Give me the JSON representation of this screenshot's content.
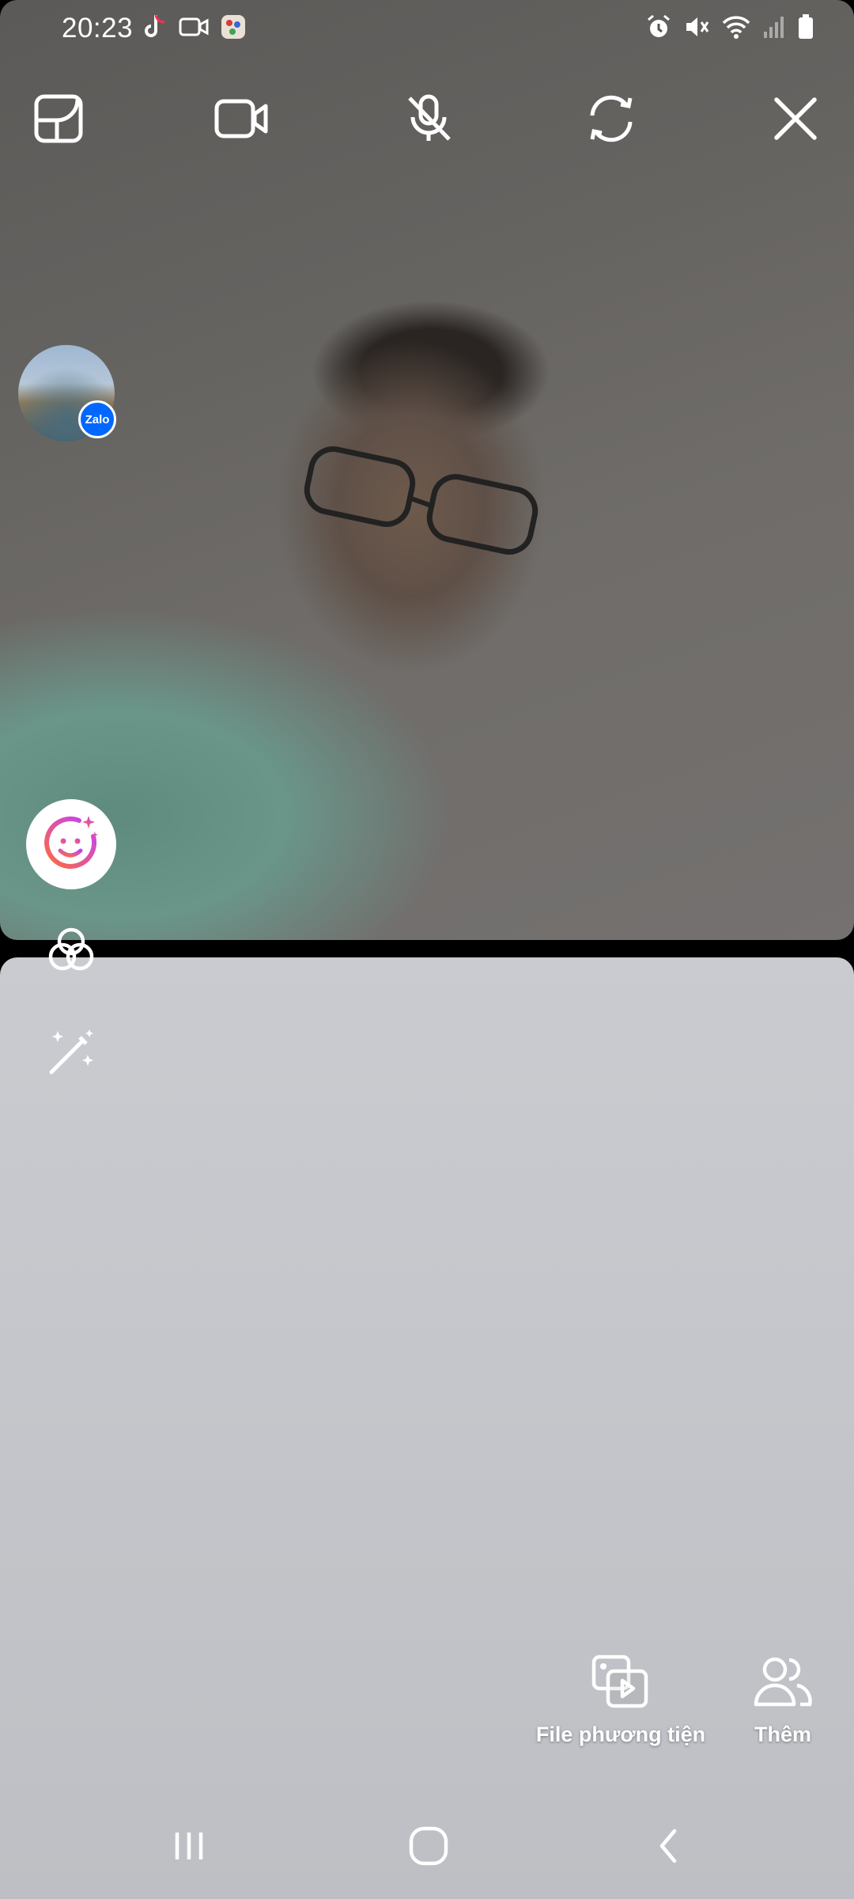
{
  "status_bar": {
    "time": "20:23",
    "left_icons": [
      "tiktok-icon",
      "video-recording-icon",
      "app-notification-icon"
    ],
    "right_icons": [
      "alarm-icon",
      "mute-icon",
      "wifi-icon",
      "signal-icon",
      "battery-icon"
    ]
  },
  "toolbar": {
    "buttons": [
      "layout-toggle-icon",
      "video-camera-icon",
      "microphone-muted-icon",
      "switch-camera-icon",
      "close-icon"
    ]
  },
  "caller": {
    "app_badge": "Zalo"
  },
  "side_tools": [
    "face-effects-icon",
    "filter-icon",
    "magic-wand-icon"
  ],
  "actions": [
    {
      "label": "File phương tiện",
      "icon": "media-file-icon"
    },
    {
      "label": "Thêm",
      "icon": "add-people-icon"
    }
  ],
  "nav_bar": [
    "recent-apps-icon",
    "home-icon",
    "back-icon"
  ],
  "colors": {
    "zalo_blue": "#0068ff",
    "face_gradient_start": "#ff6b3d",
    "face_gradient_end": "#c040ff"
  }
}
